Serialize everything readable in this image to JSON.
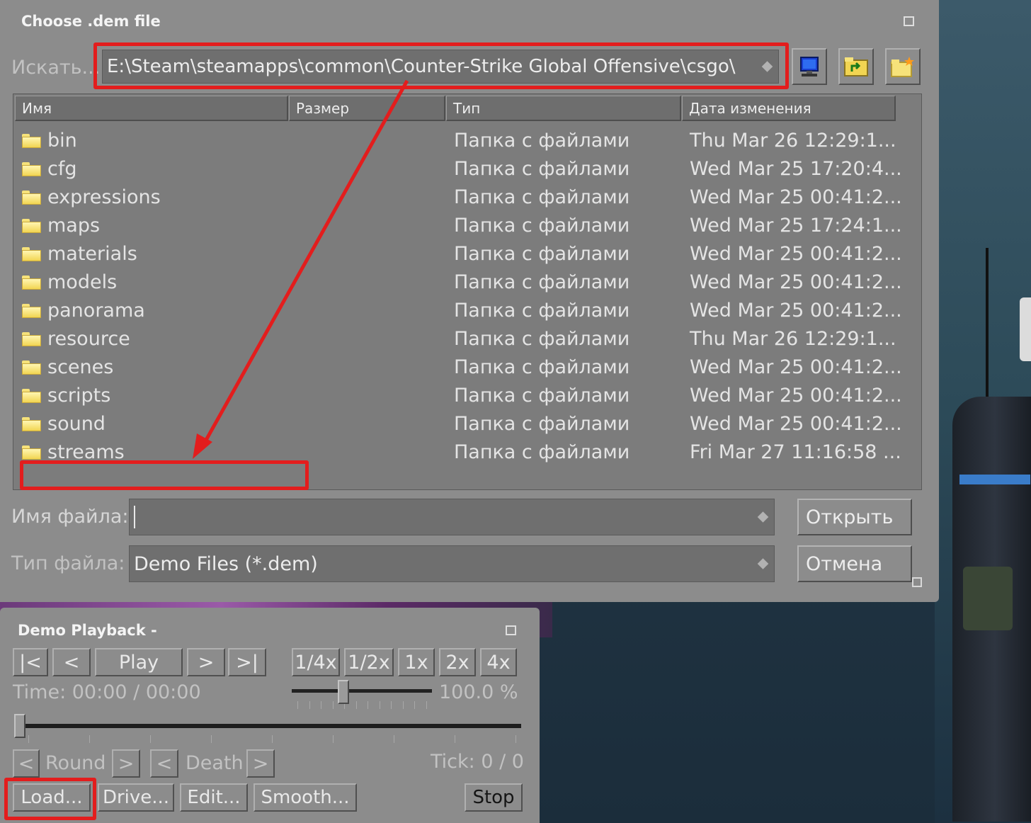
{
  "file_dialog": {
    "title": "Choose .dem file",
    "look_in_label": "Искать...",
    "path_value": "E:\\Steam\\steamapps\\common\\Counter-Strike Global Offensive\\csgo\\",
    "toolbar_icons": [
      "desktop-icon",
      "folder-up-icon",
      "new-folder-icon"
    ],
    "columns": [
      "Имя",
      "Размер",
      "Тип",
      "Дата изменения"
    ],
    "rows": [
      {
        "name": "bin",
        "size": "",
        "type": "Папка с файлами",
        "date": "Thu Mar 26 12:29:1..."
      },
      {
        "name": "cfg",
        "size": "",
        "type": "Папка с файлами",
        "date": "Wed Mar 25 17:20:4..."
      },
      {
        "name": "expressions",
        "size": "",
        "type": "Папка с файлами",
        "date": "Wed Mar 25 00:41:2..."
      },
      {
        "name": "maps",
        "size": "",
        "type": "Папка с файлами",
        "date": "Wed Mar 25 17:24:1..."
      },
      {
        "name": "materials",
        "size": "",
        "type": "Папка с файлами",
        "date": "Wed Mar 25 00:41:2..."
      },
      {
        "name": "models",
        "size": "",
        "type": "Папка с файлами",
        "date": "Wed Mar 25 00:41:2..."
      },
      {
        "name": "panorama",
        "size": "",
        "type": "Папка с файлами",
        "date": "Wed Mar 25 00:41:2..."
      },
      {
        "name": "resource",
        "size": "",
        "type": "Папка с файлами",
        "date": "Thu Mar 26 12:29:1..."
      },
      {
        "name": "scenes",
        "size": "",
        "type": "Папка с файлами",
        "date": "Wed Mar 25 00:41:2..."
      },
      {
        "name": "scripts",
        "size": "",
        "type": "Папка с файлами",
        "date": "Wed Mar 25 00:41:2..."
      },
      {
        "name": "sound",
        "size": "",
        "type": "Папка с файлами",
        "date": "Wed Mar 25 00:41:2..."
      },
      {
        "name": "streams",
        "size": "",
        "type": "Папка с файлами",
        "date": "Fri Mar 27 11:16:58 ..."
      }
    ],
    "filename_label": "Имя файла:",
    "filename_value": "",
    "filetype_label": "Тип файла:",
    "filetype_value": "Demo Files (*.dem)",
    "open_button": "Открыть",
    "cancel_button": "Отмена"
  },
  "demo_playback": {
    "title": "Demo Playback -",
    "buttons": {
      "first": "|<",
      "prev": "<",
      "play": "Play",
      "next": ">",
      "last": ">|"
    },
    "speeds": [
      "1/4x",
      "1/2x",
      "1x",
      "2x",
      "4x"
    ],
    "time_label": "Time: 00:00 / 00:00",
    "speed_percent": "100.0 %",
    "speed_fraction": 0.37,
    "progress_fraction": 0.0,
    "round_prev": "<",
    "round_label": "Round",
    "round_next": ">",
    "death_prev": "<",
    "death_label": "Death",
    "death_next": ">",
    "tick_label": "Tick: 0 / 0",
    "load_button": "Load...",
    "drive_button": "Drive...",
    "edit_button": "Edit...",
    "smooth_button": "Smooth...",
    "stop_button": "Stop"
  },
  "colors": {
    "annotation": "#e31d1d",
    "panel": "#8c8c8c",
    "folder": "#f2d552"
  }
}
